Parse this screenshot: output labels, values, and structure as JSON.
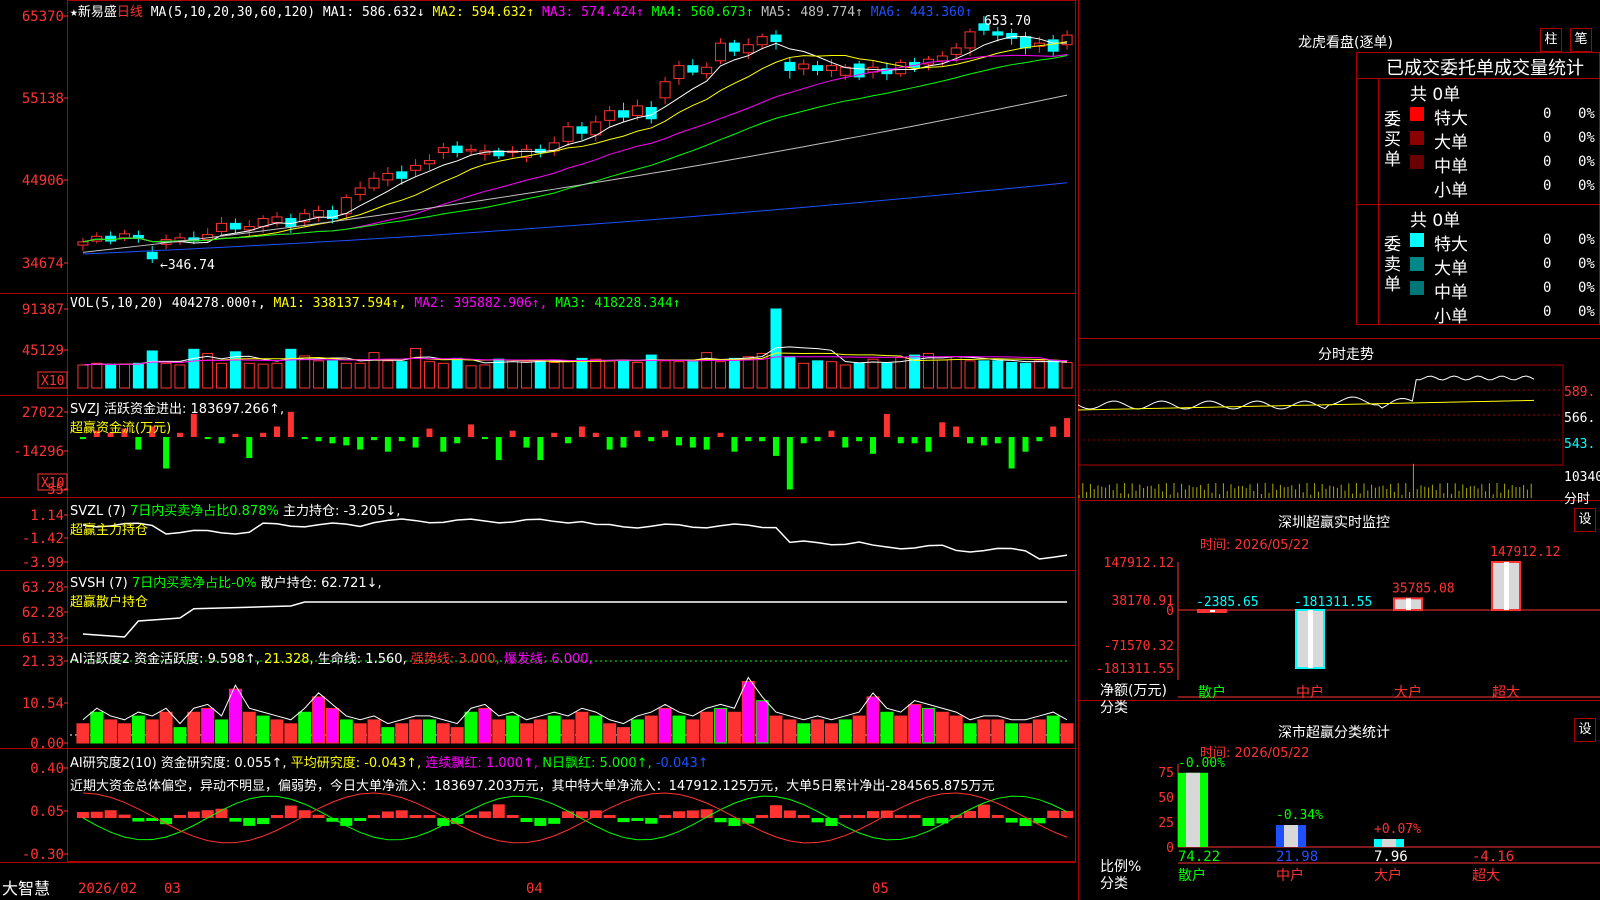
{
  "colors": {
    "up": "#ff3232",
    "down": "#00ffff",
    "grid": "#aa0000",
    "axis": "#ff3232",
    "yellow": "#ffff00",
    "magenta": "#ff00ff",
    "green": "#00ff00",
    "white": "#ffffff",
    "blue": "#1e50ff",
    "gray": "#c0c0c0"
  },
  "main": {
    "star": "★",
    "stock_name": "新易盛",
    "period": "日线",
    "ma_label": "MA(5,10,20,30,60,120)",
    "ma1": "MA1: 586.632↓",
    "ma2": "MA2: 594.632↑",
    "ma3": "MA3: 574.424↑",
    "ma4": "MA4: 560.673↑",
    "ma5": "MA5: 489.774↑",
    "ma6": "MA6: 443.360↑",
    "high_marker": "653.70",
    "low_marker": "←346.74",
    "y_ticks": [
      "65370",
      "55138",
      "44906",
      "34674"
    ]
  },
  "vol": {
    "label": "VOL(5,10,20)",
    "value": "404278.000↑,",
    "ma1": "MA1: 338137.594↑,",
    "ma2": "MA2: 395882.906↑,",
    "ma3": "MA3: 418228.344↑",
    "y_ticks": [
      "91387",
      "45129"
    ],
    "unit": "X10"
  },
  "svzj": {
    "label": "SVZJ  活跃资金进出: 183697.266↑,",
    "sub": "超赢资金流(万元)",
    "y_ticks": [
      "27022",
      "-14296",
      "-55"
    ],
    "unit": "X10"
  },
  "svzl": {
    "label": "SVZL (7)",
    "pct": "7日内买卖净占比0.878%",
    "hold": "主力持仓: -3.205↓,",
    "sub": "超赢主力持仓",
    "y_ticks": [
      "1.14",
      "-1.42",
      "-3.99"
    ]
  },
  "svsh": {
    "label": "SVSH (7)",
    "pct": "7日内买卖净占比-0%",
    "hold": "散户持仓: 62.721↓,",
    "sub": "超赢散户持仓",
    "y_ticks": [
      "63.28",
      "62.28",
      "61.33"
    ]
  },
  "ai1": {
    "label": "AI活跃度2 资金活跃度: 9.598↑,",
    "v2": "21.328,",
    "life": "生命线: 1.560,",
    "strong": "强势线: 3.000,",
    "burst": "爆发线: 6.000,",
    "y_ticks": [
      "21.33",
      "10.54",
      "0.00"
    ]
  },
  "ai2": {
    "label": "AI研究度2(10) 资金研究度: 0.055↑,",
    "avg": "平均研究度: -0.043↑,",
    "cont": "连续飘红: 1.000↑,",
    "nday": "N日飘红: 5.000↑,",
    "last": "-0.043↑",
    "comment": "近期大资金总体偏空，异动不明显，偏弱势，今日大单净流入：183697.203万元，其中特大单净流入：147912.125万元，大单5日累计净出-284565.875万元",
    "y_ticks": [
      "0.40",
      "0.05",
      "-0.30"
    ]
  },
  "xaxis": {
    "brand": "大智慧",
    "labels": [
      "2026/02",
      "03",
      "04",
      "05"
    ]
  },
  "right": {
    "lhkp": {
      "title": "龙虎看盘(逐单)",
      "btn1": "柱",
      "btn2": "笔",
      "header": "已成交委托单成交量统计",
      "buy": {
        "side": "委买单",
        "total": "共 0单",
        "rows": [
          {
            "name": "特大",
            "v": "0",
            "p": "0%",
            "color": "#ff0000"
          },
          {
            "name": "大单",
            "v": "0",
            "p": "0%",
            "color": "#8b0000"
          },
          {
            "name": "中单",
            "v": "0",
            "p": "0%",
            "color": "#6b0000"
          },
          {
            "name": "小单",
            "v": "0",
            "p": "0%",
            "color": ""
          }
        ]
      },
      "sell": {
        "side": "委卖单",
        "total": "共 0单",
        "rows": [
          {
            "name": "特大",
            "v": "0",
            "p": "0%",
            "color": "#00ffff"
          },
          {
            "name": "大单",
            "v": "0",
            "p": "0%",
            "color": "#008888"
          },
          {
            "name": "中单",
            "v": "0",
            "p": "0%",
            "color": "#007777"
          },
          {
            "name": "小单",
            "v": "0",
            "p": "0%",
            "color": ""
          }
        ]
      }
    },
    "fenshi": {
      "title": "分时走势",
      "y_ticks": [
        "589.",
        "566.",
        "543."
      ],
      "vol_label": "10340",
      "period_label": "分时"
    },
    "monitor": {
      "title": "深圳超赢实时监控",
      "btn": "设",
      "time": "时间: 2026/05/22",
      "y_ticks": [
        "147912.12",
        "38170.91",
        "0",
        "-71570.32",
        "-181311.55"
      ],
      "ylabel": "净额(万元)",
      "xlabel": "分类",
      "cats": [
        "散户",
        "中户",
        "大户",
        "超大"
      ],
      "values": [
        -2385.65,
        -181311.55,
        35785.08,
        147912.12
      ],
      "value_labels": [
        "-2385.65",
        "-181311.55",
        "35785.08",
        "147912.12"
      ]
    },
    "classify": {
      "title": "深市超赢分类统计",
      "btn": "设",
      "time": "时间: 2026/05/22",
      "y_ticks": [
        "75",
        "50",
        "25",
        "0"
      ],
      "ylabel": "比例%",
      "xlabel": "分类",
      "cats": [
        "散户",
        "中户",
        "大户",
        "超大"
      ],
      "values": [
        74.22,
        21.98,
        7.96,
        -4.16
      ],
      "value_labels": [
        "74.22",
        "21.98",
        "7.96",
        "-4.16"
      ],
      "change_labels": [
        "-0.00%",
        "-0.34%",
        "+0.07%",
        ""
      ]
    }
  },
  "chart_data": [
    {
      "type": "candlestick",
      "name": "新易盛 日线",
      "ylim": [
        326.74,
        653.7
      ],
      "dates_start": "2026/02",
      "candles": [
        [
          369,
          373,
          362,
          378
        ],
        [
          374,
          380,
          371,
          385
        ],
        [
          380,
          374,
          370,
          386
        ],
        [
          378,
          383,
          374,
          388
        ],
        [
          381,
          378,
          372,
          387
        ],
        [
          360,
          352,
          346.74,
          368
        ],
        [
          370,
          376,
          364,
          382
        ],
        [
          373,
          378,
          369,
          384
        ],
        [
          378,
          374,
          370,
          386
        ],
        [
          376,
          382,
          372,
          390
        ],
        [
          386,
          396,
          380,
          404
        ],
        [
          396,
          389,
          384,
          402
        ],
        [
          388,
          392,
          380,
          400
        ],
        [
          392,
          402,
          384,
          406
        ],
        [
          397,
          404,
          392,
          410
        ],
        [
          402,
          392,
          384,
          408
        ],
        [
          398,
          408,
          392,
          414
        ],
        [
          404,
          412,
          398,
          418
        ],
        [
          412,
          402,
          396,
          418
        ],
        [
          408,
          428,
          400,
          432
        ],
        [
          432,
          440,
          424,
          448
        ],
        [
          440,
          452,
          436,
          460
        ],
        [
          450,
          458,
          442,
          466
        ],
        [
          460,
          452,
          444,
          468
        ],
        [
          462,
          468,
          454,
          476
        ],
        [
          470,
          474,
          462,
          482
        ],
        [
          484,
          490,
          476,
          496
        ],
        [
          492,
          484,
          478,
          498
        ],
        [
          486,
          488,
          480,
          494
        ],
        [
          482,
          486,
          474,
          494
        ],
        [
          486,
          480,
          476,
          490
        ],
        [
          484,
          486,
          478,
          492
        ],
        [
          478,
          488,
          472,
          494
        ],
        [
          488,
          484,
          478,
          494
        ],
        [
          486,
          496,
          480,
          504
        ],
        [
          498,
          516,
          492,
          522
        ],
        [
          516,
          508,
          500,
          522
        ],
        [
          506,
          522,
          498,
          530
        ],
        [
          524,
          536,
          516,
          542
        ],
        [
          536,
          528,
          522,
          546
        ],
        [
          530,
          542,
          524,
          550
        ],
        [
          540,
          526,
          520,
          548
        ],
        [
          552,
          572,
          544,
          578
        ],
        [
          576,
          592,
          568,
          598
        ],
        [
          592,
          584,
          580,
          600
        ],
        [
          582,
          590,
          576,
          596
        ],
        [
          598,
          620,
          594,
          626
        ],
        [
          620,
          610,
          604,
          624
        ],
        [
          608,
          618,
          600,
          626
        ],
        [
          618,
          628,
          612,
          632
        ],
        [
          630,
          622,
          612,
          636
        ],
        [
          596,
          586,
          576,
          602
        ],
        [
          588,
          594,
          580,
          600
        ],
        [
          592,
          586,
          580,
          598
        ],
        [
          586,
          592,
          578,
          600
        ],
        [
          580,
          590,
          574,
          594
        ],
        [
          594,
          578,
          574,
          598
        ],
        [
          584,
          590,
          576,
          598
        ],
        [
          588,
          582,
          574,
          596
        ],
        [
          582,
          596,
          578,
          600
        ],
        [
          596,
          590,
          584,
          602
        ],
        [
          594,
          600,
          586,
          604
        ],
        [
          598,
          604,
          590,
          610
        ],
        [
          606,
          614,
          596,
          620
        ],
        [
          614,
          634,
          604,
          638
        ],
        [
          644,
          636,
          630,
          653.7
        ],
        [
          634,
          630,
          622,
          640
        ],
        [
          632,
          626,
          618,
          638
        ],
        [
          628,
          614,
          606,
          634
        ],
        [
          616,
          620,
          608,
          628
        ],
        [
          624,
          610,
          604,
          630
        ],
        [
          618,
          630,
          612,
          636
        ]
      ]
    },
    {
      "type": "bar",
      "name": "VOL",
      "values": [
        280,
        300,
        280,
        290,
        300,
        450,
        300,
        280,
        470,
        420,
        300,
        440,
        300,
        290,
        300,
        470,
        390,
        330,
        330,
        300,
        300,
        430,
        330,
        320,
        480,
        320,
        300,
        360,
        270,
        280,
        350,
        340,
        320,
        330,
        310,
        330,
        360,
        350,
        330,
        330,
        310,
        400,
        330,
        320,
        330,
        430,
        320,
        360,
        380,
        420,
        960,
        380,
        300,
        330,
        320,
        280,
        300,
        350,
        300,
        370,
        400,
        420,
        340,
        380,
        330,
        330,
        330,
        310,
        300,
        330,
        330,
        310
      ]
    },
    {
      "type": "bar",
      "name": "SVZJ",
      "values": [
        -2,
        6,
        4,
        8,
        -12,
        10,
        -30,
        4,
        22,
        -2,
        -6,
        3,
        -20,
        4,
        10,
        24,
        -2,
        -4,
        -6,
        -8,
        -12,
        -3,
        -14,
        -4,
        -10,
        8,
        -14,
        -6,
        12,
        -2,
        -22,
        6,
        -10,
        -22,
        4,
        -6,
        10,
        4,
        -12,
        -10,
        6,
        -4,
        6,
        -8,
        -10,
        -12,
        4,
        -14,
        -4,
        -4,
        -18,
        -50,
        -6,
        -4,
        6,
        -10,
        -4,
        -16,
        22,
        -6,
        -6,
        -14,
        14,
        10,
        -6,
        -8,
        -6,
        -30,
        -14,
        -4,
        10,
        18
      ]
    },
    {
      "type": "line",
      "name": "SVZL",
      "ylim": [
        -3.99,
        1.14
      ]
    },
    {
      "type": "line",
      "name": "SVSH",
      "ylim": [
        61.33,
        63.28
      ]
    },
    {
      "type": "bar",
      "name": "AI活跃度2",
      "ylim": [
        0,
        21.33
      ],
      "values": [
        5,
        8,
        6,
        5,
        7,
        6,
        8,
        4,
        8,
        9,
        6,
        14,
        8,
        7,
        6,
        5,
        8,
        12,
        9,
        6,
        5,
        6,
        4,
        5,
        6,
        6,
        5,
        4,
        8,
        9,
        6,
        7,
        5,
        6,
        7,
        6,
        8,
        7,
        5,
        4,
        6,
        7,
        9,
        7,
        6,
        8,
        9,
        8,
        16,
        11,
        7,
        6,
        5,
        6,
        5,
        6,
        7,
        12,
        8,
        7,
        10,
        9,
        8,
        7,
        5,
        6,
        6,
        5,
        5,
        6,
        7,
        5
      ]
    },
    {
      "type": "bar",
      "name": "AI研究度2",
      "ylim": [
        -0.3,
        0.4
      ]
    },
    {
      "type": "bar",
      "name": "深圳超赢实时监控",
      "categories": [
        "散户",
        "中户",
        "大户",
        "超大"
      ],
      "values": [
        -2385.65,
        -181311.55,
        35785.08,
        147912.12
      ],
      "ylim": [
        -181311.55,
        147912.12
      ],
      "ylabel": "净额(万元)",
      "xlabel": "分类"
    },
    {
      "type": "bar",
      "name": "深市超赢分类统计",
      "categories": [
        "散户",
        "中户",
        "大户",
        "超大"
      ],
      "values": [
        74.22,
        21.98,
        7.96,
        -4.16
      ],
      "ylim": [
        0,
        75
      ],
      "ylabel": "比例%",
      "xlabel": "分类"
    }
  ]
}
